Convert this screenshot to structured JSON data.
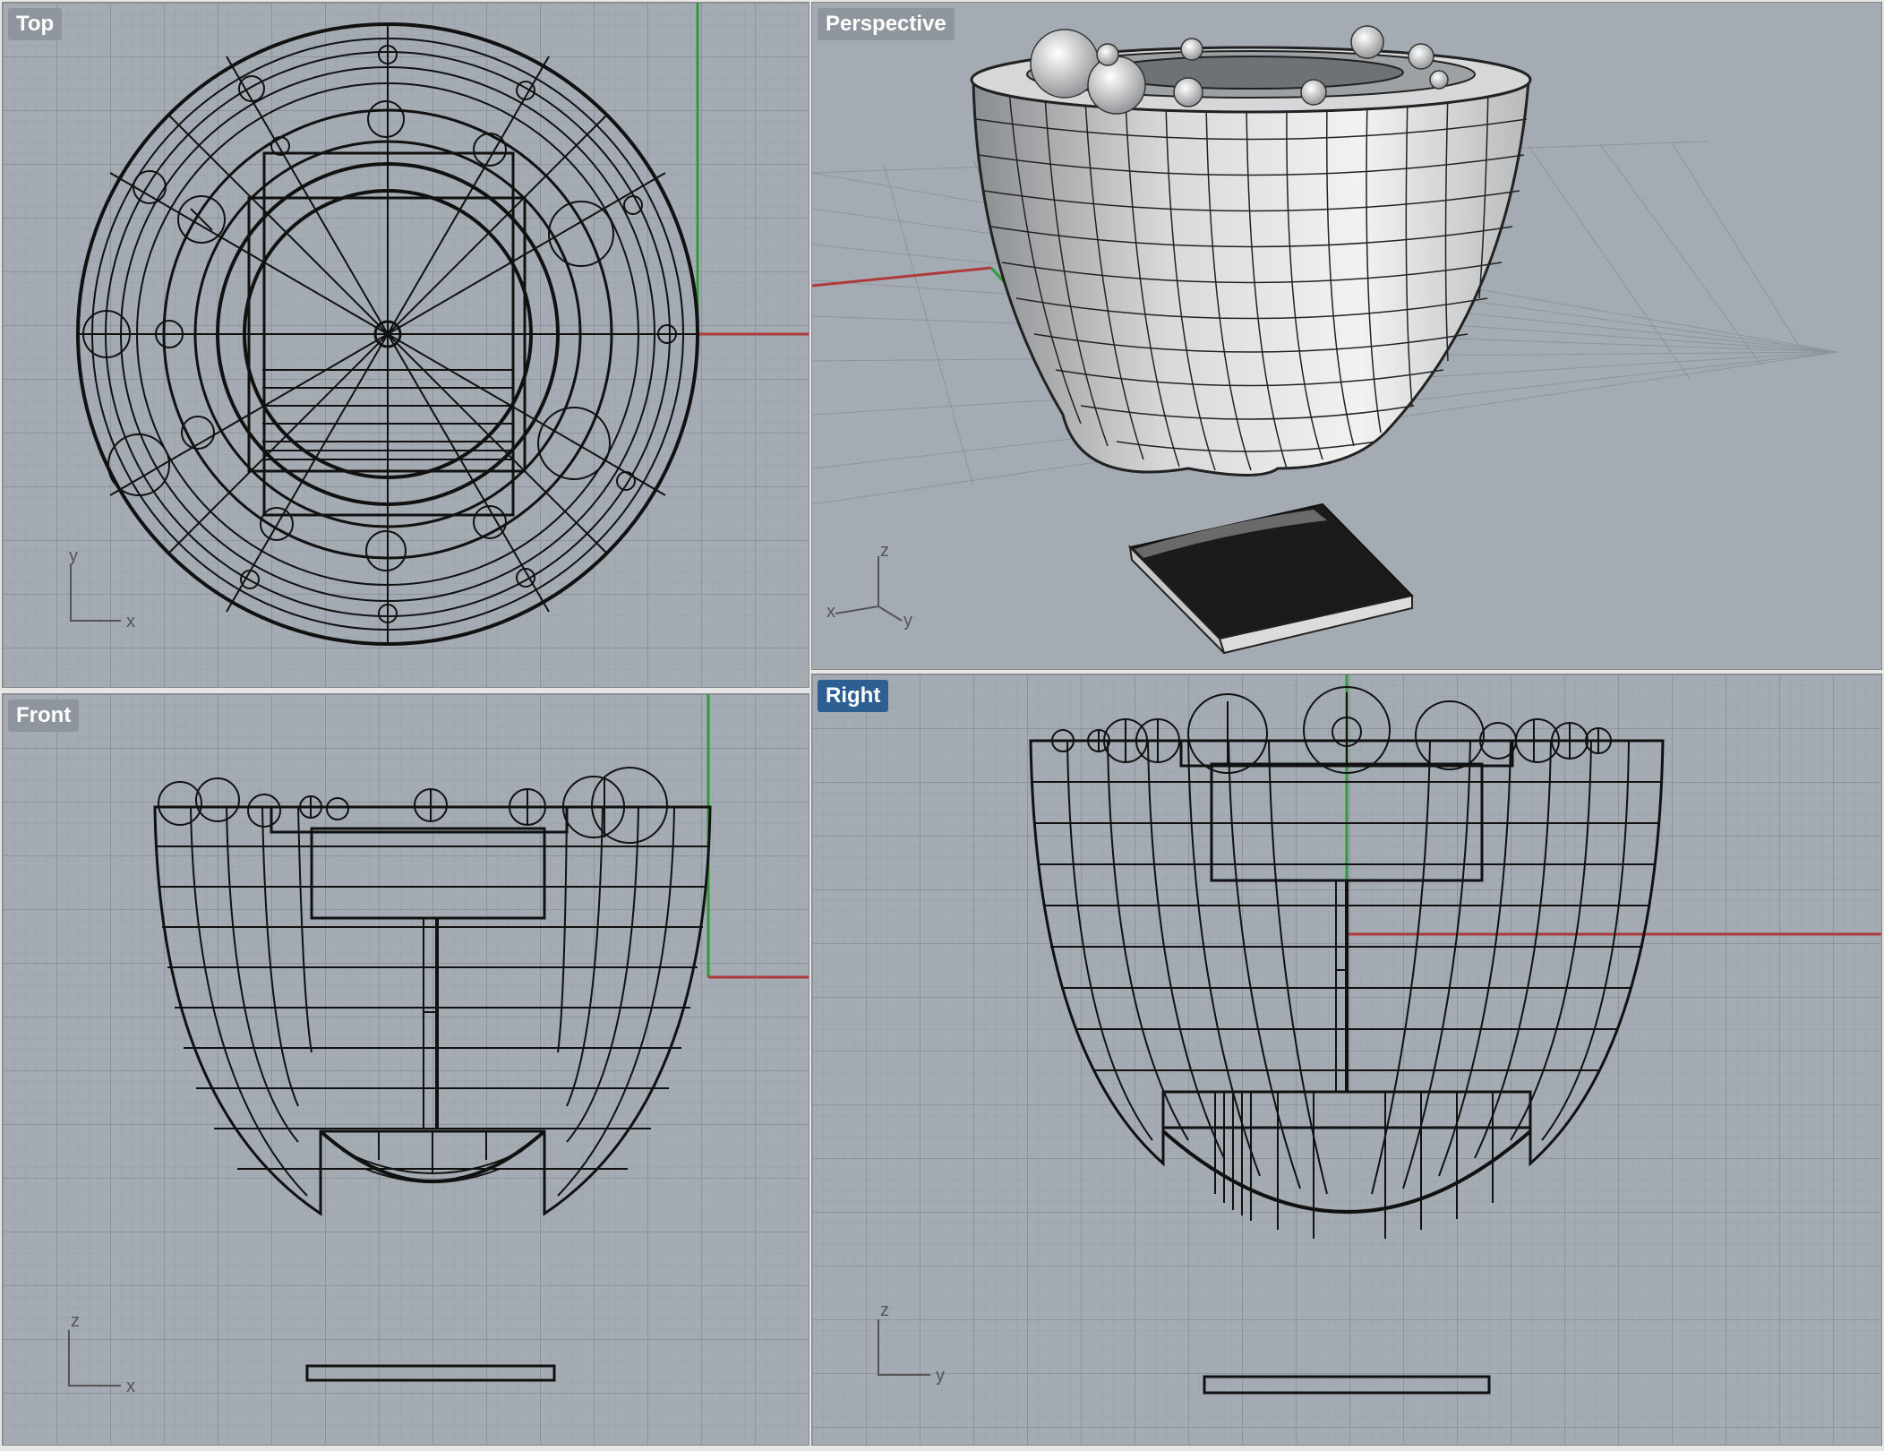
{
  "viewports": {
    "top": {
      "label": "Top",
      "axes": [
        "y",
        "x"
      ],
      "active": false
    },
    "perspective": {
      "label": "Perspective",
      "axes": [
        "z",
        "x",
        "y"
      ],
      "active": false
    },
    "front": {
      "label": "Front",
      "axes": [
        "z",
        "x"
      ],
      "active": false
    },
    "right": {
      "label": "Right",
      "axes": [
        "z",
        "y"
      ],
      "active": true
    }
  },
  "colors": {
    "viewport_bg": "#a4abb3",
    "grid_fine": "#9aa1a9",
    "grid_major": "#8b929a",
    "x_axis": "#b03a3a",
    "y_axis": "#2f9a3a",
    "wire": "#111111",
    "label_bg": "#8f959c",
    "label_active_bg": "#2e5f93"
  },
  "icons": [
    "axis-triad-icon"
  ]
}
